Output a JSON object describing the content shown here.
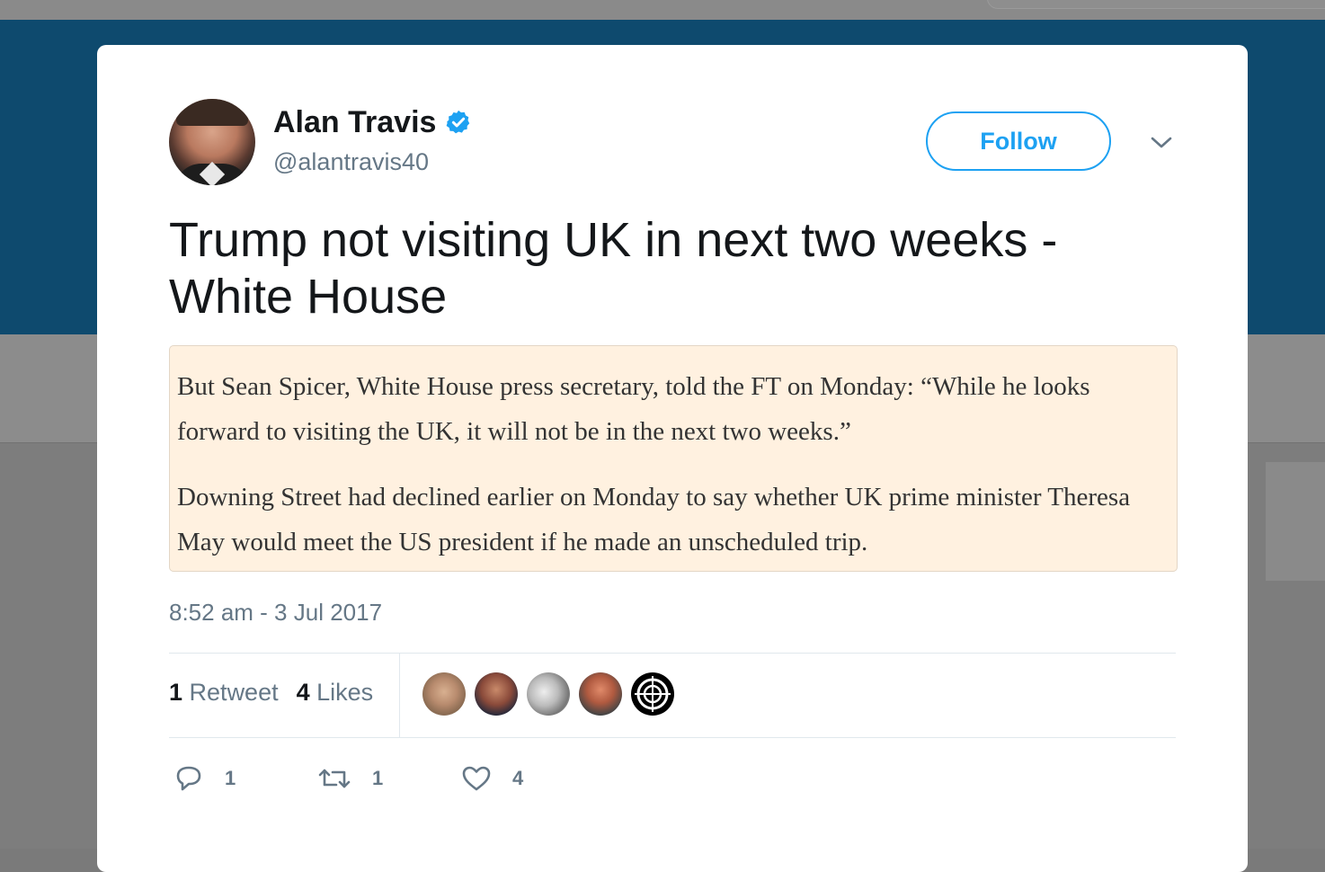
{
  "tweet": {
    "author": {
      "display_name": "Alan Travis",
      "handle": "@alantravis40",
      "verified": true
    },
    "follow_label": "Follow",
    "text": "Trump not visiting UK in next two weeks - White House",
    "quote_image_text": {
      "paragraph1": "But Sean Spicer, White House press secretary, told the FT on Monday: “While he looks forward to visiting the UK, it will not be in the next two weeks.”",
      "paragraph2": "Downing Street had declined earlier on Monday to say whether UK prime minister Theresa May would meet the US president if he made an unscheduled trip."
    },
    "timestamp": "8:52 am - 3 Jul 2017",
    "stats": {
      "retweets_count": "1",
      "retweets_label": "Retweet",
      "likes_count": "4",
      "likes_label": "Likes"
    },
    "liker_avatars": [
      "liker-avatar",
      "liker-avatar",
      "liker-avatar",
      "liker-avatar",
      "crosshair-logo-avatar"
    ],
    "actions": {
      "reply_count": "1",
      "retweet_count": "1",
      "like_count": "4"
    }
  },
  "colors": {
    "link_blue": "#1da1f2",
    "verified_blue": "#1da1f2",
    "secondary_text": "#657786",
    "quote_background": "#fff1e0",
    "header_band": "#0e4a6e"
  },
  "icons": {
    "verified": "verified-badge-icon",
    "caret": "chevron-down-icon",
    "reply": "reply-icon",
    "retweet": "retweet-icon",
    "like": "heart-icon"
  }
}
